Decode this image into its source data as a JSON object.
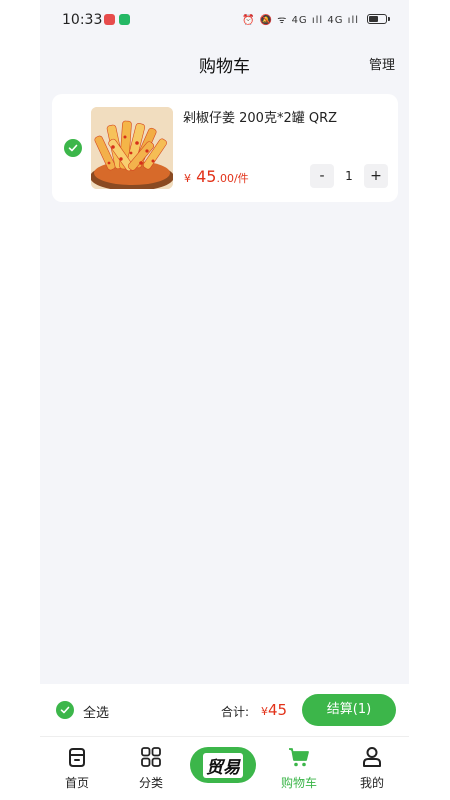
{
  "status_bar": {
    "time": "10:33",
    "signal_text": "⏰ 🔕 ᯤ 4G ıll 4G ıll"
  },
  "header": {
    "title": "购物车",
    "manage_label": "管理"
  },
  "cart": {
    "items": [
      {
        "name": "剁椒仔姜 200克*2罐 QRZ",
        "price_symbol": "¥",
        "price_int": "45",
        "price_dec": ".00",
        "price_unit": "/件",
        "quantity": "1",
        "minus_label": "-",
        "plus_label": "+",
        "selected": true
      }
    ]
  },
  "checkout": {
    "select_all_label": "全选",
    "total_label": "合计:",
    "total_symbol": "¥",
    "total_amount": "45",
    "pay_label": "结算(1)"
  },
  "tabbar": {
    "items": [
      {
        "label": "首页",
        "icon": "home-icon",
        "active": false
      },
      {
        "label": "分类",
        "icon": "category-grid-icon",
        "active": false
      },
      {
        "label": "贸易",
        "icon": "trade-logo",
        "active": false
      },
      {
        "label": "购物车",
        "icon": "cart-icon",
        "active": true
      },
      {
        "label": "我的",
        "icon": "profile-icon",
        "active": false
      }
    ]
  },
  "colors": {
    "accent": "#3cb64a",
    "price": "#e2331a",
    "background": "#f4f5f9"
  }
}
